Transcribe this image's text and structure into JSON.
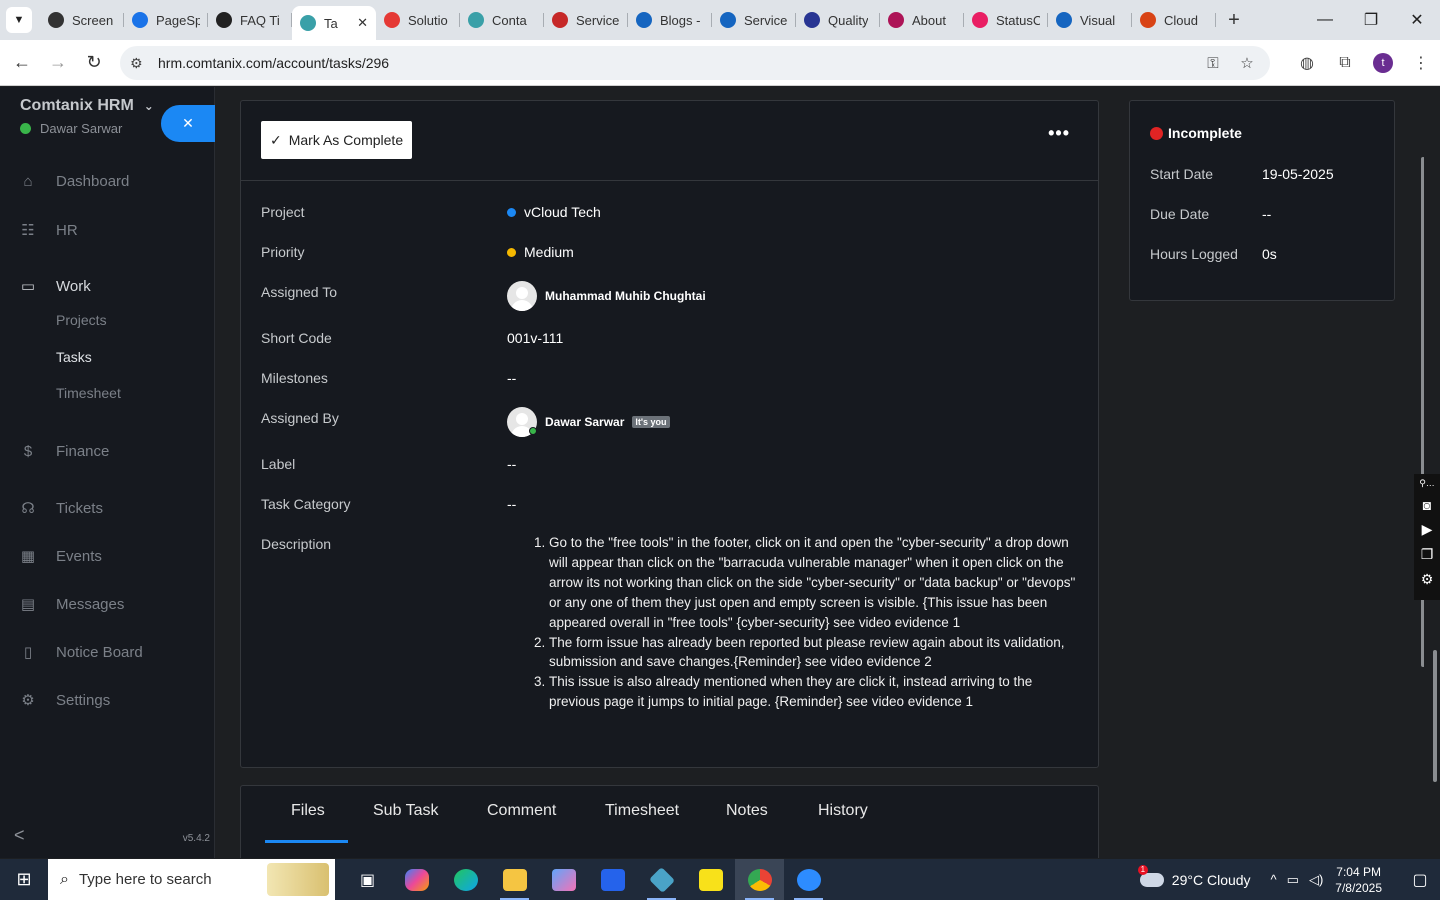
{
  "browser": {
    "tabs": [
      {
        "title": "Screen",
        "color": "#333333",
        "icon": "screencast-icon"
      },
      {
        "title": "PageSp",
        "color": "#1a73e8",
        "icon": "pagespeed-icon"
      },
      {
        "title": "FAQ Ti",
        "color": "#222222",
        "icon": "faq-icon"
      },
      {
        "title": "Ta",
        "color": "#3aa0a8",
        "icon": "hrm-icon",
        "active": true
      },
      {
        "title": "Solutio",
        "color": "#e53935",
        "icon": "solution-icon"
      },
      {
        "title": "Conta",
        "color": "#3aa0a8",
        "icon": "contact-icon"
      },
      {
        "title": "Service",
        "color": "#c62828",
        "icon": "service-icon"
      },
      {
        "title": "Blogs -",
        "color": "#1565c0",
        "icon": "blogs-icon"
      },
      {
        "title": "Service",
        "color": "#1565c0",
        "icon": "service-check-icon"
      },
      {
        "title": "Quality",
        "color": "#283593",
        "icon": "quality-icon"
      },
      {
        "title": "About",
        "color": "#ad1457",
        "icon": "about-icon"
      },
      {
        "title": "StatusC",
        "color": "#e91e63",
        "icon": "status-icon"
      },
      {
        "title": "Visual",
        "color": "#1565c0",
        "icon": "visual-icon"
      },
      {
        "title": "Cloud",
        "color": "#d84315",
        "icon": "cloud-icon"
      }
    ],
    "url": "hrm.comtanix.com/account/tasks/296",
    "profile_initial": "t"
  },
  "sidebar": {
    "brand": "Comtanix HRM",
    "user": "Dawar Sarwar",
    "menu": [
      {
        "label": "Dashboard",
        "icon": "home-icon",
        "glyph": "⌂"
      },
      {
        "label": "HR",
        "icon": "users-icon",
        "glyph": "☷"
      },
      {
        "label": "Work",
        "icon": "briefcase-icon",
        "glyph": "▭"
      },
      {
        "label": "Finance",
        "icon": "dollar-icon",
        "glyph": "$"
      },
      {
        "label": "Tickets",
        "icon": "headset-icon",
        "glyph": "☊"
      },
      {
        "label": "Events",
        "icon": "calendar-icon",
        "glyph": "▦"
      },
      {
        "label": "Messages",
        "icon": "message-icon",
        "glyph": "▤"
      },
      {
        "label": "Notice Board",
        "icon": "clipboard-icon",
        "glyph": "▯"
      },
      {
        "label": "Settings",
        "icon": "gear-icon",
        "glyph": "⚙"
      }
    ],
    "work_sub": [
      "Projects",
      "Tasks",
      "Timesheet"
    ],
    "version": "v5.4.2"
  },
  "task": {
    "mark_complete": "Mark As Complete",
    "fields": {
      "project": {
        "label": "Project",
        "value": "vCloud Tech",
        "color": "#1b88f4"
      },
      "priority": {
        "label": "Priority",
        "value": "Medium",
        "color": "#f5b800"
      },
      "assigned_to": {
        "label": "Assigned To",
        "value": "Muhammad Muhib Chughtai"
      },
      "short_code": {
        "label": "Short Code",
        "value": "001v-111"
      },
      "milestones": {
        "label": "Milestones",
        "value": "--"
      },
      "assigned_by": {
        "label": "Assigned By",
        "value": "Dawar Sarwar",
        "badge": "It's you"
      },
      "label": {
        "label": "Label",
        "value": "--"
      },
      "task_category": {
        "label": "Task Category",
        "value": "--"
      },
      "description": {
        "label": "Description"
      }
    },
    "description_items": [
      "Go to the \"free tools\" in the footer, click on it and open the \"cyber-security\" a drop down will appear than click on the \"barracuda vulnerable manager\" when it open click on the arrow its not working than click on the side \"cyber-security\" or \"data backup\" or \"devops\" or any one of them they just open and empty screen is visible. {This issue has been appeared overall in \"free tools\" {cyber-security} see video evidence 1",
      "The form issue has already been reported but please review again about its validation, submission and save changes.{Reminder} see video evidence 2",
      "This issue is also already mentioned when they are click it, instead arriving to the previous page it jumps to initial page. {Reminder} see video evidence 1"
    ],
    "status": "Incomplete",
    "start_date": {
      "label": "Start Date",
      "value": "19-05-2025"
    },
    "due_date": {
      "label": "Due Date",
      "value": "--"
    },
    "hours_logged": {
      "label": "Hours Logged",
      "value": "0s"
    }
  },
  "tabs": [
    "Files",
    "Sub Task",
    "Comment",
    "Timesheet",
    "Notes",
    "History"
  ],
  "taskbar": {
    "search_placeholder": "Type here to search",
    "weather": "29°C  Cloudy",
    "weather_badge": "1",
    "time": "7:04 PM",
    "date": "7/8/2025"
  }
}
